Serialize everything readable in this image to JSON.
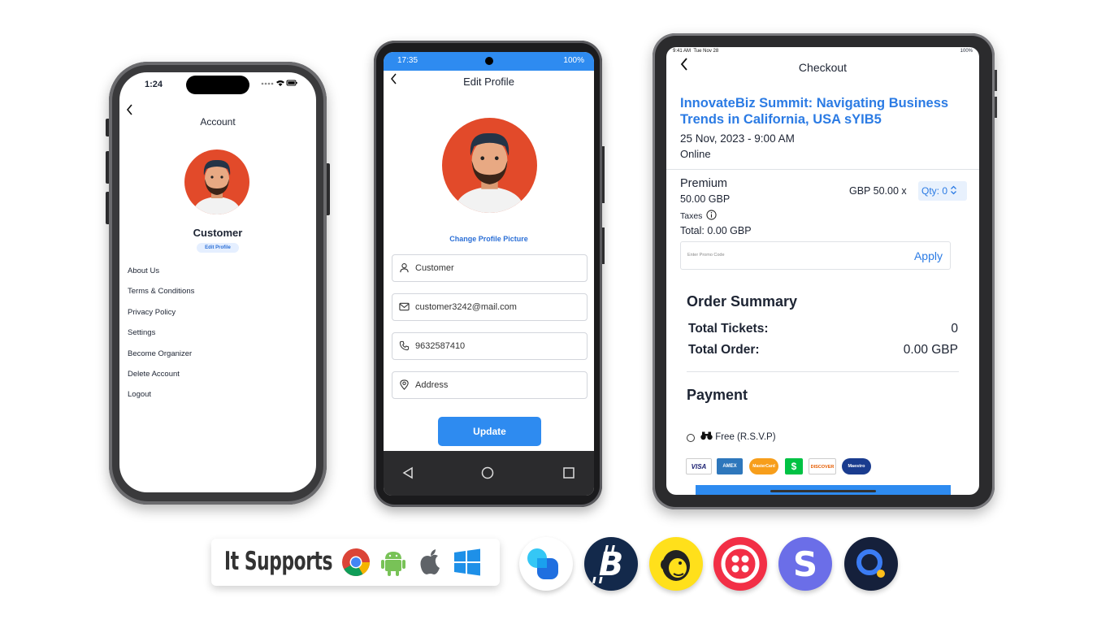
{
  "iphone": {
    "time": "1:24",
    "title": "Account",
    "user_name": "Customer",
    "edit_profile": "Edit Profile",
    "menu": [
      {
        "label": "About Us"
      },
      {
        "label": "Terms & Conditions"
      },
      {
        "label": "Privacy Policy"
      },
      {
        "label": "Settings"
      },
      {
        "label": "Become Organizer"
      },
      {
        "label": "Delete Account"
      },
      {
        "label": "Logout"
      }
    ]
  },
  "android": {
    "time": "17:35",
    "battery": "100%",
    "title": "Edit Profile",
    "change_picture": "Change Profile Picture",
    "fields": {
      "name": "Customer",
      "email": "customer3242@mail.com",
      "phone": "9632587410",
      "address": "Address"
    },
    "update_label": "Update"
  },
  "ipad": {
    "status_time": "9:41 AM",
    "status_date": "Tue Nov 28",
    "battery": "100%",
    "title": "Checkout",
    "event_title": "InnovateBiz Summit: Navigating Business Trends in California, USA sYIB5",
    "event_date": "25 Nov, 2023 - 9:00 AM",
    "event_mode": "Online",
    "ticket_name": "Premium",
    "ticket_price": "50.00 GBP",
    "taxes_label": "Taxes",
    "ticket_total": "Total: 0.00 GBP",
    "unit_price": "GBP 50.00 x",
    "qty_label": "Qty: 0",
    "promo_placeholder": "Enter Promo Code",
    "apply_label": "Apply",
    "order_summary_title": "Order Summary",
    "total_tickets_label": "Total Tickets:",
    "total_tickets_value": "0",
    "total_order_label": "Total Order:",
    "total_order_value": "0.00 GBP",
    "payment_title": "Payment",
    "free_option": "Free (R.S.V.P)",
    "cards": [
      "VISA",
      "AMEX",
      "MasterCard",
      "$",
      "DISCOVER",
      "Maestro"
    ]
  },
  "supports": {
    "label": "It Supports",
    "platforms": [
      "chrome-icon",
      "android-icon",
      "apple-icon",
      "windows-icon"
    ]
  },
  "integrations": [
    "stripe-icon",
    "bitcoin-icon",
    "mailchimp-icon",
    "twilio-icon",
    "skrill-icon",
    "razorpay-icon"
  ],
  "colors": {
    "accent": "#2e8bf0",
    "link": "#2b7be4",
    "avatar_bg": "#e24a2a"
  }
}
